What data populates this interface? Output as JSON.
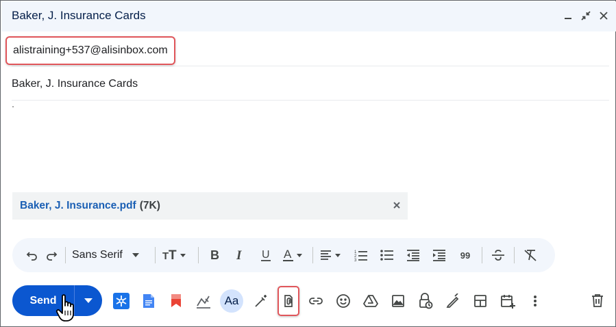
{
  "window": {
    "title": "Baker, J. Insurance Cards",
    "icons": [
      "minimize-icon",
      "exit-fullscreen-icon",
      "close-icon"
    ]
  },
  "to": {
    "recipient": "alistraining+537@alisinbox.com"
  },
  "subject": {
    "value": "Baker, J. Insurance Cards"
  },
  "attachment": {
    "name": "Baker, J. Insurance.pdf",
    "size": "(7K)"
  },
  "format_bar": {
    "font": "Sans Serif",
    "quote_glyph": "99"
  },
  "bottom_bar": {
    "send_label": "Send",
    "aa_label": "Aa"
  },
  "colors": {
    "accent": "#0b57d0",
    "highlight": "#e0555a",
    "header_bg": "#f2f6fc",
    "link": "#1a5fb4"
  }
}
